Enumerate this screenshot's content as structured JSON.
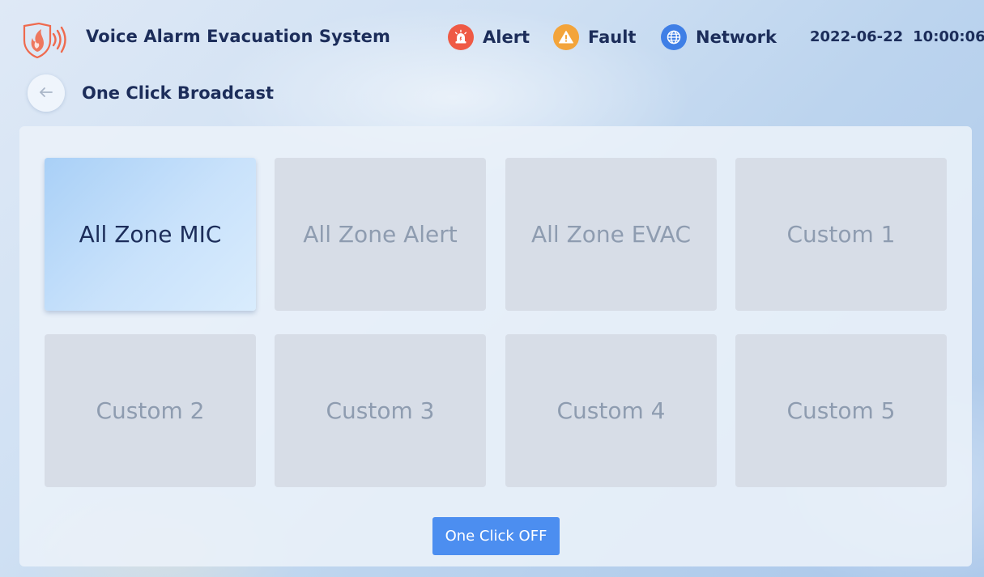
{
  "header": {
    "app_title": "Voice Alarm Evacuation System",
    "logo_icon": "fire-sound-logo-icon",
    "status": [
      {
        "label": "Alert",
        "icon": "siren-icon",
        "color": "#ef5a45"
      },
      {
        "label": "Fault",
        "icon": "warning-triangle-icon",
        "color": "#f3a43a"
      },
      {
        "label": "Network",
        "icon": "globe-icon",
        "color": "#3f7fe6"
      }
    ],
    "date": "2022-06-22",
    "time": "10:00:06"
  },
  "page": {
    "back_icon": "arrow-left-icon",
    "title": "One Click Broadcast"
  },
  "tiles": [
    {
      "label": "All Zone MIC",
      "selected": true
    },
    {
      "label": "All Zone Alert",
      "selected": false
    },
    {
      "label": "All Zone EVAC",
      "selected": false
    },
    {
      "label": "Custom 1",
      "selected": false
    },
    {
      "label": "Custom 2",
      "selected": false
    },
    {
      "label": "Custom 3",
      "selected": false
    },
    {
      "label": "Custom 4",
      "selected": false
    },
    {
      "label": "Custom 5",
      "selected": false
    }
  ],
  "footer": {
    "off_button_label": "One Click OFF"
  },
  "colors": {
    "text_primary": "#1c2d5a",
    "tile_selected": "#b8d9fa",
    "tile_disabled_text": "#8e9cb0",
    "button_primary": "#4c8ef0"
  }
}
